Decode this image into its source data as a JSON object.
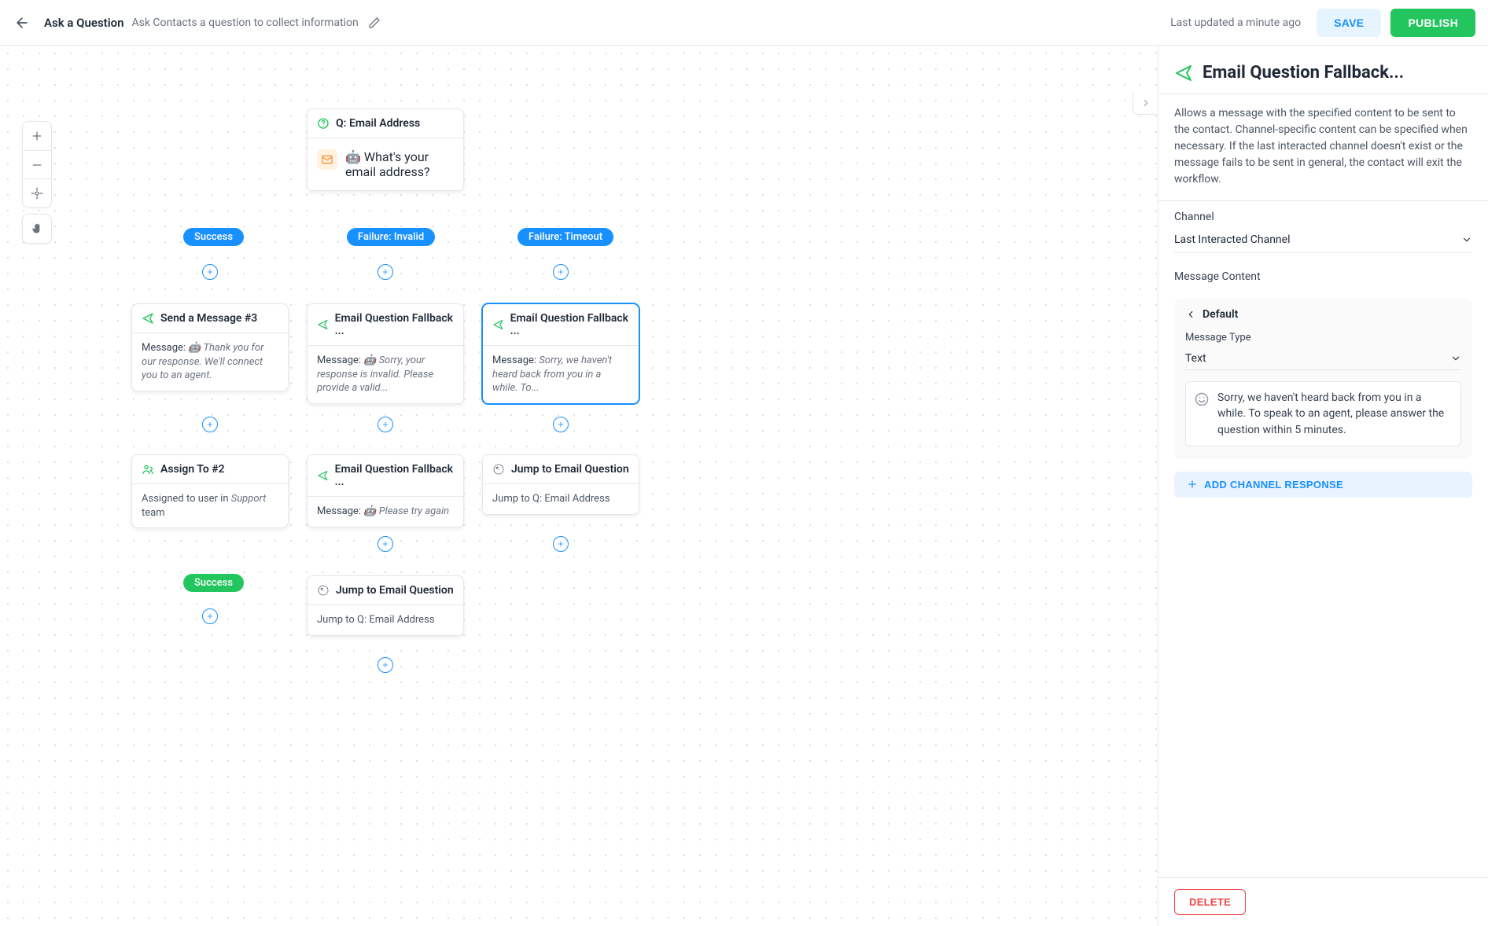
{
  "topbar": {
    "title": "Ask a Question",
    "subtitle": "Ask Contacts a question to collect information",
    "last_updated": "Last updated a minute ago",
    "save": "SAVE",
    "publish": "PUBLISH"
  },
  "panel": {
    "title": "Email Question Fallback...",
    "description": "Allows a message with the specified content to be sent to the contact. Channel-specific content can be specified when necessary. If the last interacted channel doesn't exist or the message fails to be sent in general, the contact will exit the workflow.",
    "channel_label": "Channel",
    "channel_value": "Last Interacted Channel",
    "message_content_label": "Message Content",
    "default_label": "Default",
    "message_type_label": "Message Type",
    "message_type_value": "Text",
    "message_body": "Sorry, we haven't heard back from you in a while. To speak to an agent, please answer the question within 5 minutes.",
    "add_channel_response": "ADD CHANNEL RESPONSE",
    "delete": "DELETE"
  },
  "pills": {
    "success1": "Success",
    "failure_invalid": "Failure: Invalid",
    "failure_timeout": "Failure: Timeout",
    "success2": "Success"
  },
  "nodes": {
    "email_q": {
      "title": "Q: Email Address",
      "body": "🤖 What's your email address?"
    },
    "send_msg_3": {
      "title": "Send a Message #3",
      "msg_label": "Message:",
      "body": "🤖 Thank you for our response. We'll connect you to an agent."
    },
    "fb_invalid": {
      "title": "Email Question Fallback ...",
      "msg_label": "Message:",
      "body": "🤖 Sorry, your response is invalid. Please provide a valid..."
    },
    "fb_timeout": {
      "title": "Email Question Fallback ...",
      "msg_label": "Message:",
      "body": "Sorry, we haven't heard back from you in a while. To..."
    },
    "assign": {
      "title": "Assign To #2",
      "prefix": "Assigned to user in ",
      "team": "Support",
      "suffix": " team"
    },
    "fb_tryagain": {
      "title": "Email Question Fallback ...",
      "msg_label": "Message:",
      "body": "🤖 Please try again"
    },
    "jump1": {
      "title": "Jump to Email Question",
      "body": "Jump to Q: Email Address"
    },
    "jump2": {
      "title": "Jump to Email Question",
      "body": "Jump to Q: Email Address"
    }
  }
}
